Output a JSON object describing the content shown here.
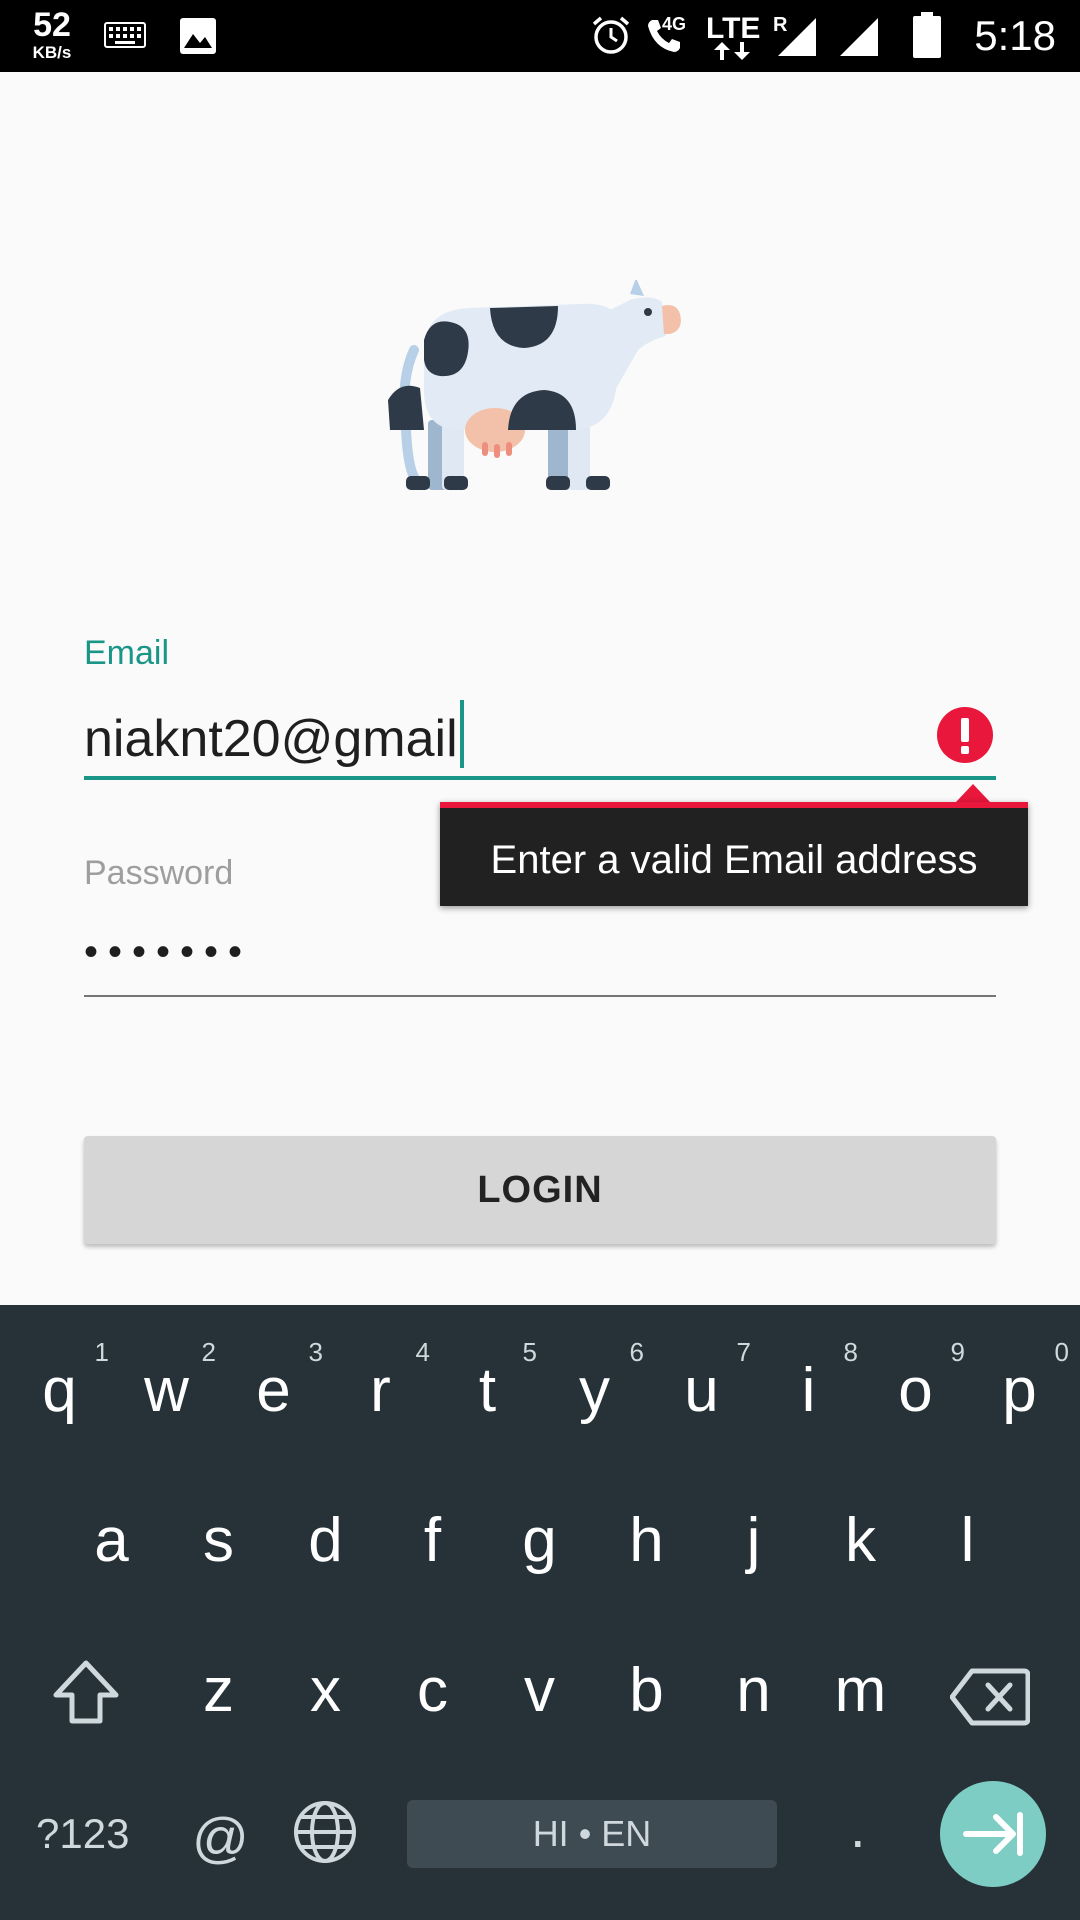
{
  "status_bar": {
    "speed_value": "52",
    "speed_unit": "KB/s",
    "network": "4G",
    "lte": "LTE",
    "roaming": "R",
    "time": "5:18",
    "icons": [
      "keyboard-icon",
      "image-icon",
      "alarm-icon",
      "call-icon",
      "signal-icon",
      "signal-icon",
      "battery-icon"
    ]
  },
  "form": {
    "email_label": "Email",
    "email_value": "niaknt20@gmail",
    "error_tooltip": "Enter a valid Email address",
    "password_label": "Password",
    "password_value": "•••••••",
    "login_label": "LOGIN"
  },
  "keyboard": {
    "row1": [
      "q",
      "w",
      "e",
      "r",
      "t",
      "y",
      "u",
      "i",
      "o",
      "p"
    ],
    "row1_hints": [
      "1",
      "2",
      "3",
      "4",
      "5",
      "6",
      "7",
      "8",
      "9",
      "0"
    ],
    "row2": [
      "a",
      "s",
      "d",
      "f",
      "g",
      "h",
      "j",
      "k",
      "l"
    ],
    "row3": [
      "z",
      "x",
      "c",
      "v",
      "b",
      "n",
      "m"
    ],
    "symbols_key": "?123",
    "at_key": "@",
    "space_label": "HI • EN",
    "period_key": "."
  },
  "colors": {
    "accent": "#1a9688",
    "error": "#e8173b",
    "keyboard_bg": "#263238",
    "enter_key": "#7ecdc4"
  }
}
